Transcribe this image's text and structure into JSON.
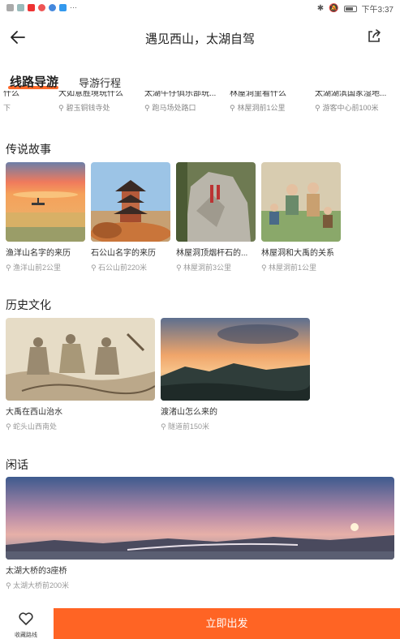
{
  "status": {
    "time": "下午3:37"
  },
  "header": {
    "title": "遇见西山，太湖自驾"
  },
  "tabs": [
    {
      "label": "线路导游"
    },
    {
      "label": "导游行程"
    }
  ],
  "prev_items": [
    {
      "title": "什么",
      "loc": "下"
    },
    {
      "title": "大如意胜境玩什么",
      "loc": "碧玉铜钱寺处"
    },
    {
      "title": "太湖牛仔俱乐部玩...",
      "loc": "跑马场处路口"
    },
    {
      "title": "林屋洞里看什么",
      "loc": "林屋洞前1公里"
    },
    {
      "title": "太湖湖滨国家湿地...",
      "loc": "游客中心前100米"
    }
  ],
  "sections": {
    "legend": {
      "title": "传说故事",
      "items": [
        {
          "title": "渔洋山名字的来历",
          "loc": "渔洋山前2公里"
        },
        {
          "title": "石公山名字的来历",
          "loc": "石公山前220米"
        },
        {
          "title": "林屋洞顶烟杆石的...",
          "loc": "林屋洞前3公里"
        },
        {
          "title": "林屋洞和大禹的关系",
          "loc": "林屋洞前1公里"
        }
      ]
    },
    "history": {
      "title": "历史文化",
      "items": [
        {
          "title": "大禹在西山治水",
          "loc": "蛇头山西南处"
        },
        {
          "title": "渡渚山怎么来的",
          "loc": "隧道前150米"
        }
      ]
    },
    "chat": {
      "title": "闲话",
      "items": [
        {
          "title": "太湖大桥的3座桥",
          "loc": "太湖大桥前200米"
        }
      ]
    }
  },
  "bottom": {
    "fav_label": "收藏路线",
    "go_label": "立即出发"
  },
  "colors": {
    "accent": "#ff6424"
  }
}
